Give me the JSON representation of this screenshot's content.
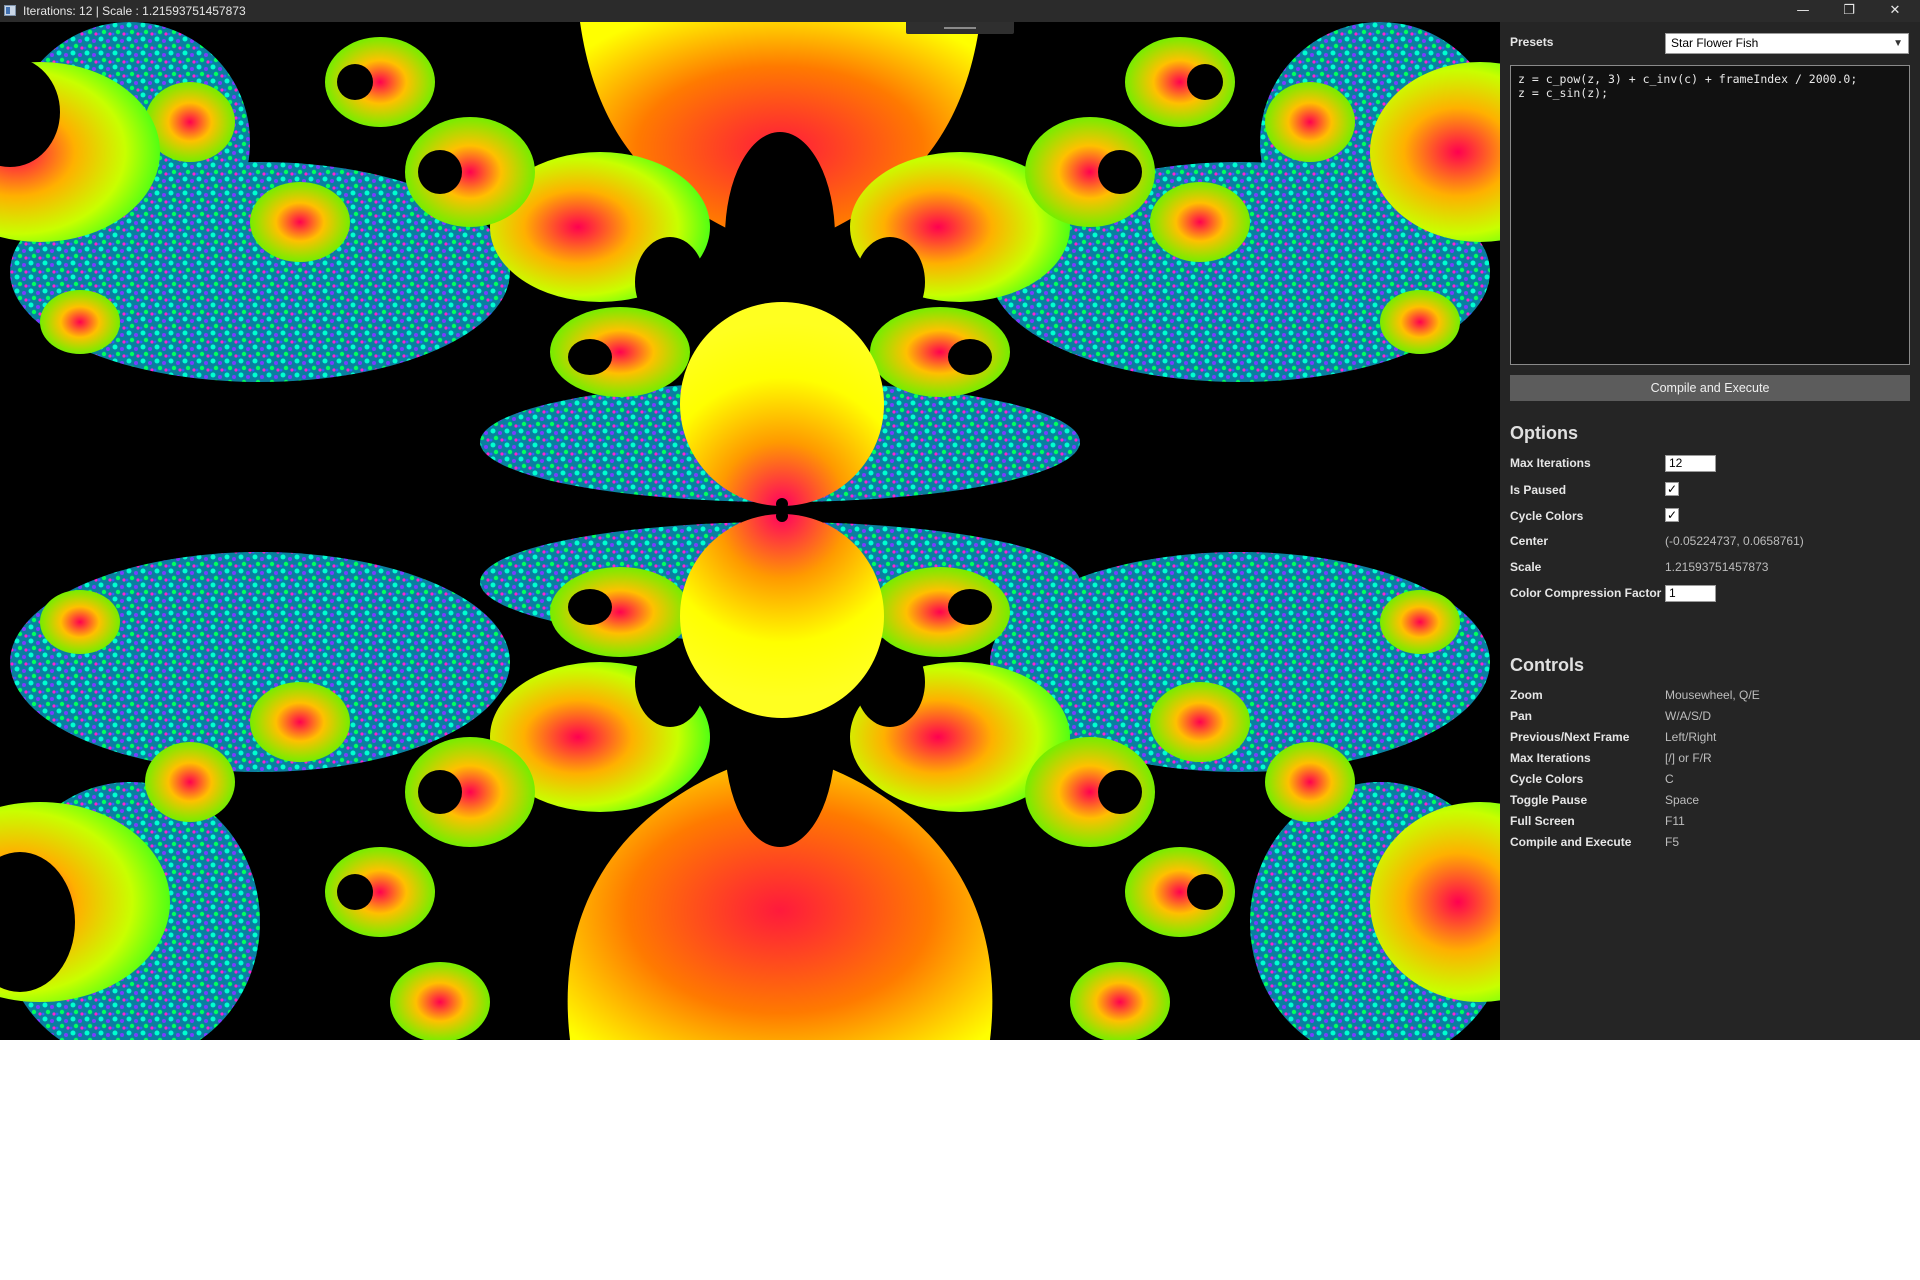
{
  "window": {
    "title": "Iterations: 12 | Scale : 1.21593751457873",
    "controls": {
      "minimize": "—",
      "maximize": "❐",
      "close": "✕"
    }
  },
  "panel": {
    "presets": {
      "label": "Presets",
      "selected": "Star Flower Fish"
    },
    "code": "z = c_pow(z, 3) + c_inv(c) + frameIndex / 2000.0;\nz = c_sin(z);",
    "compile_label": "Compile and Execute",
    "options": {
      "heading": "Options",
      "max_iterations": {
        "label": "Max Iterations",
        "value": "12"
      },
      "is_paused": {
        "label": "Is Paused",
        "checked": true
      },
      "cycle_colors": {
        "label": "Cycle Colors",
        "checked": true
      },
      "center": {
        "label": "Center",
        "value": "(-0.05224737, 0.0658761)"
      },
      "scale": {
        "label": "Scale",
        "value": "1.21593751457873"
      },
      "color_compression": {
        "label": "Color Compression Factor",
        "value": "1"
      }
    },
    "controls": {
      "heading": "Controls",
      "items": [
        {
          "name": "Zoom",
          "keys": "Mousewheel, Q/E"
        },
        {
          "name": "Pan",
          "keys": "W/A/S/D"
        },
        {
          "name": "Previous/Next Frame",
          "keys": "Left/Right"
        },
        {
          "name": "Max Iterations",
          "keys": "[/] or F/R"
        },
        {
          "name": "Cycle Colors",
          "keys": "C"
        },
        {
          "name": "Toggle Pause",
          "keys": "Space"
        },
        {
          "name": "Full Screen",
          "keys": "F11"
        },
        {
          "name": "Compile and Execute",
          "keys": "F5"
        }
      ]
    }
  },
  "colors": {
    "titlebar": "#2b2b2b",
    "panel": "#252525",
    "fractal_palette": [
      "#ffff00",
      "#ff0040",
      "#00ff00",
      "#00ffff",
      "#4040ff",
      "#ff00ff"
    ]
  }
}
